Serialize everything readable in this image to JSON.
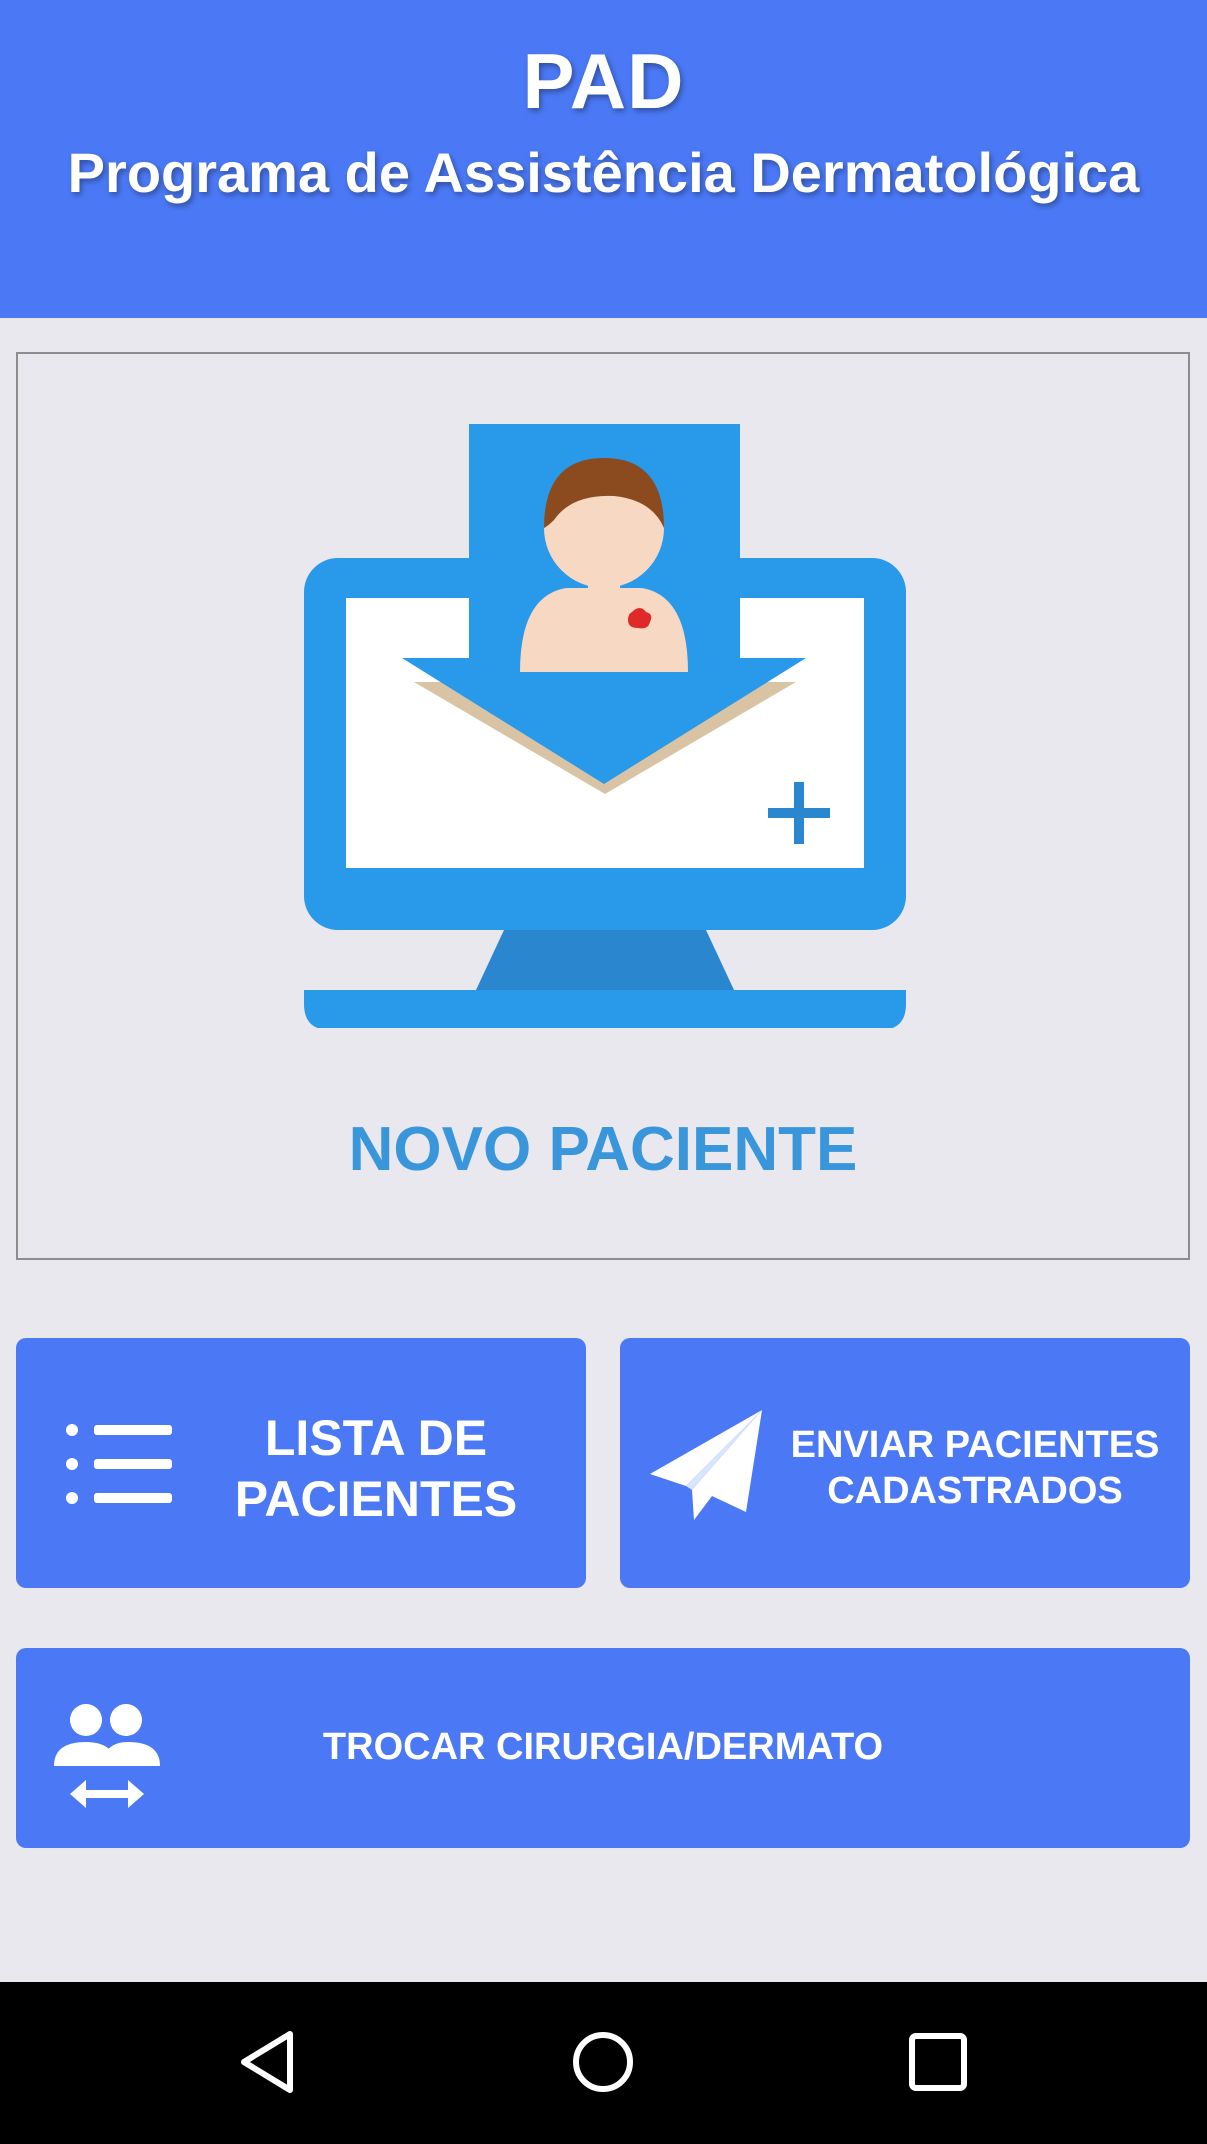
{
  "header": {
    "title": "PAD",
    "subtitle": "Programa de Assistência Dermatológica",
    "background": "#4b79f6"
  },
  "new_patient": {
    "label": "NOVO PACIENTE",
    "illustration": "computer-with-patient-icon",
    "accent": "#3a96db"
  },
  "buttons": {
    "list_patients": {
      "line1": "LISTA DE",
      "line2": "PACIENTES",
      "icon": "list-icon"
    },
    "send_patients": {
      "line1": "ENVIAR PACIENTES",
      "line2": "CADASTRADOS",
      "icon": "paper-plane-icon"
    },
    "switch_mode": {
      "label": "TROCAR CIRURGIA/DERMATO",
      "icon": "people-swap-icon"
    }
  },
  "nav": {
    "back": "back-icon",
    "home": "home-icon",
    "recent": "recent-apps-icon"
  }
}
